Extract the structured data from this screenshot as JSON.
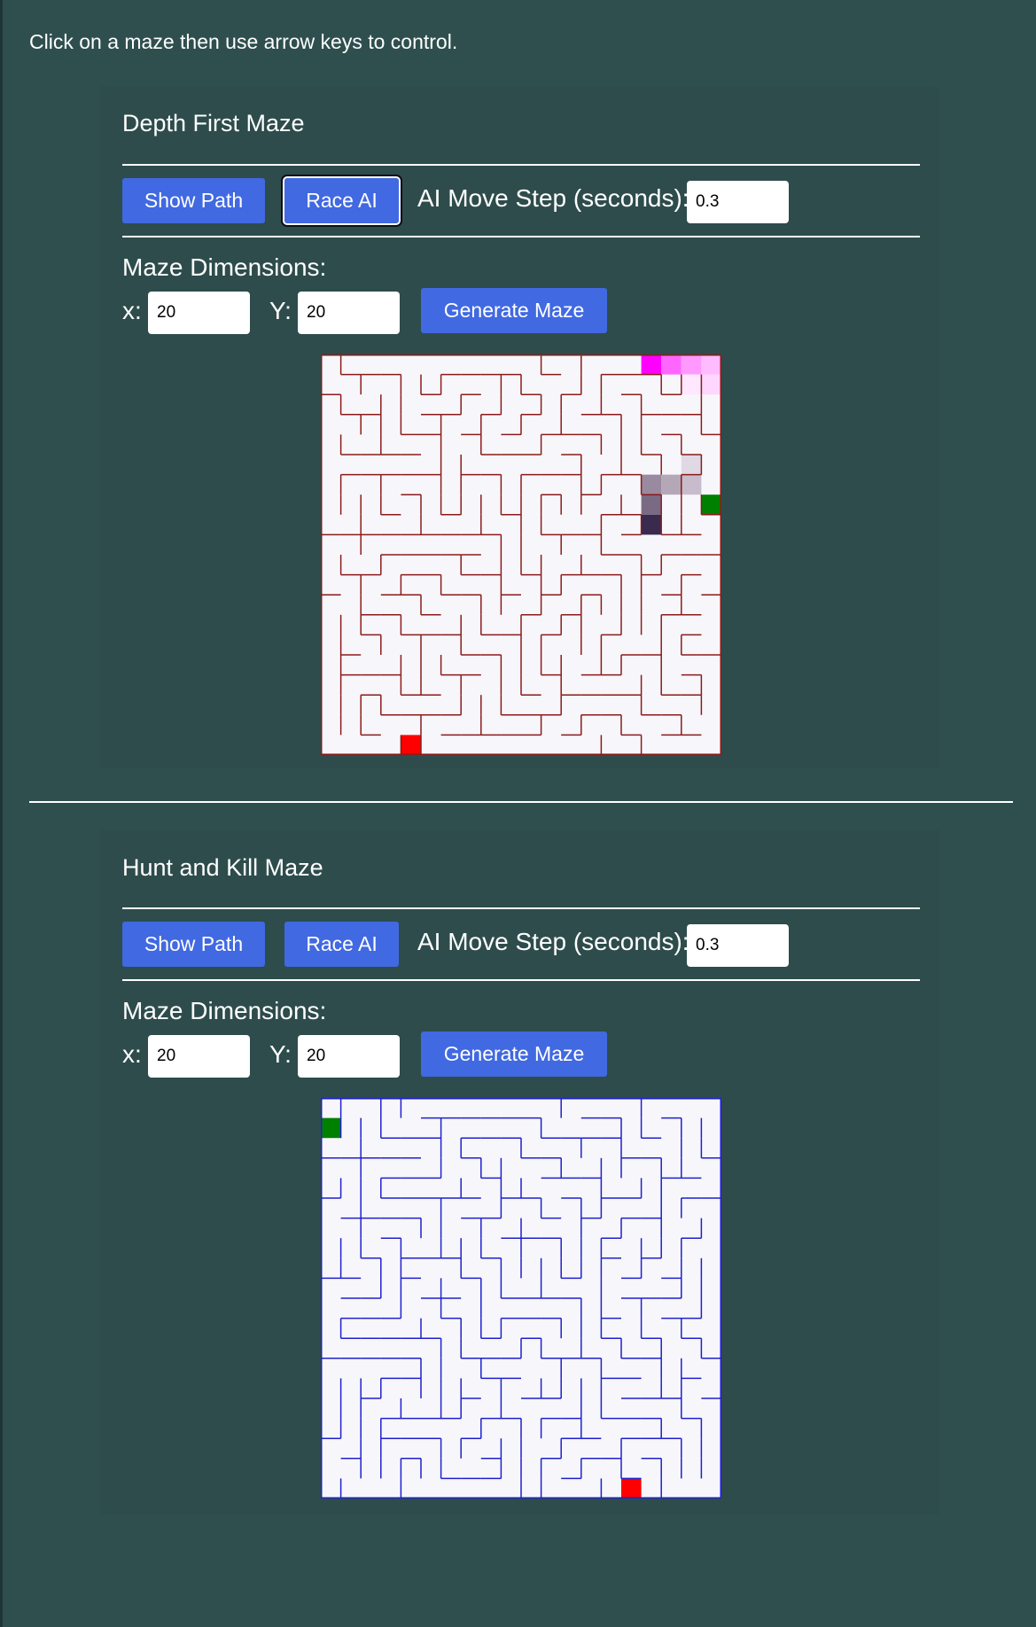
{
  "instructions": "Click on a maze then use arrow keys to control.",
  "mazes": [
    {
      "title": "Depth First Maze",
      "show_path_label": "Show Path",
      "race_ai_label": "Race AI",
      "step_label": "AI Move Step (seconds):",
      "step_value": "0.3",
      "dimensions_label": "Maze Dimensions:",
      "x_label": "x:",
      "x_value": "20",
      "y_label": "Y:",
      "y_value": "20",
      "generate_label": "Generate Maze",
      "grid_size": 20,
      "wall_color": "#8b1a1a",
      "goal_color": "#ff0000",
      "player_color": "#008000"
    },
    {
      "title": "Hunt and Kill Maze",
      "show_path_label": "Show Path",
      "race_ai_label": "Race AI",
      "step_label": "AI Move Step (seconds):",
      "step_value": "0.3",
      "dimensions_label": "Maze Dimensions:",
      "x_label": "x:",
      "x_value": "20",
      "y_label": "Y:",
      "y_value": "20",
      "generate_label": "Generate Maze",
      "grid_size": 20,
      "wall_color": "#1f1fcf",
      "goal_color": "#ff0000",
      "player_color": "#008000"
    }
  ]
}
